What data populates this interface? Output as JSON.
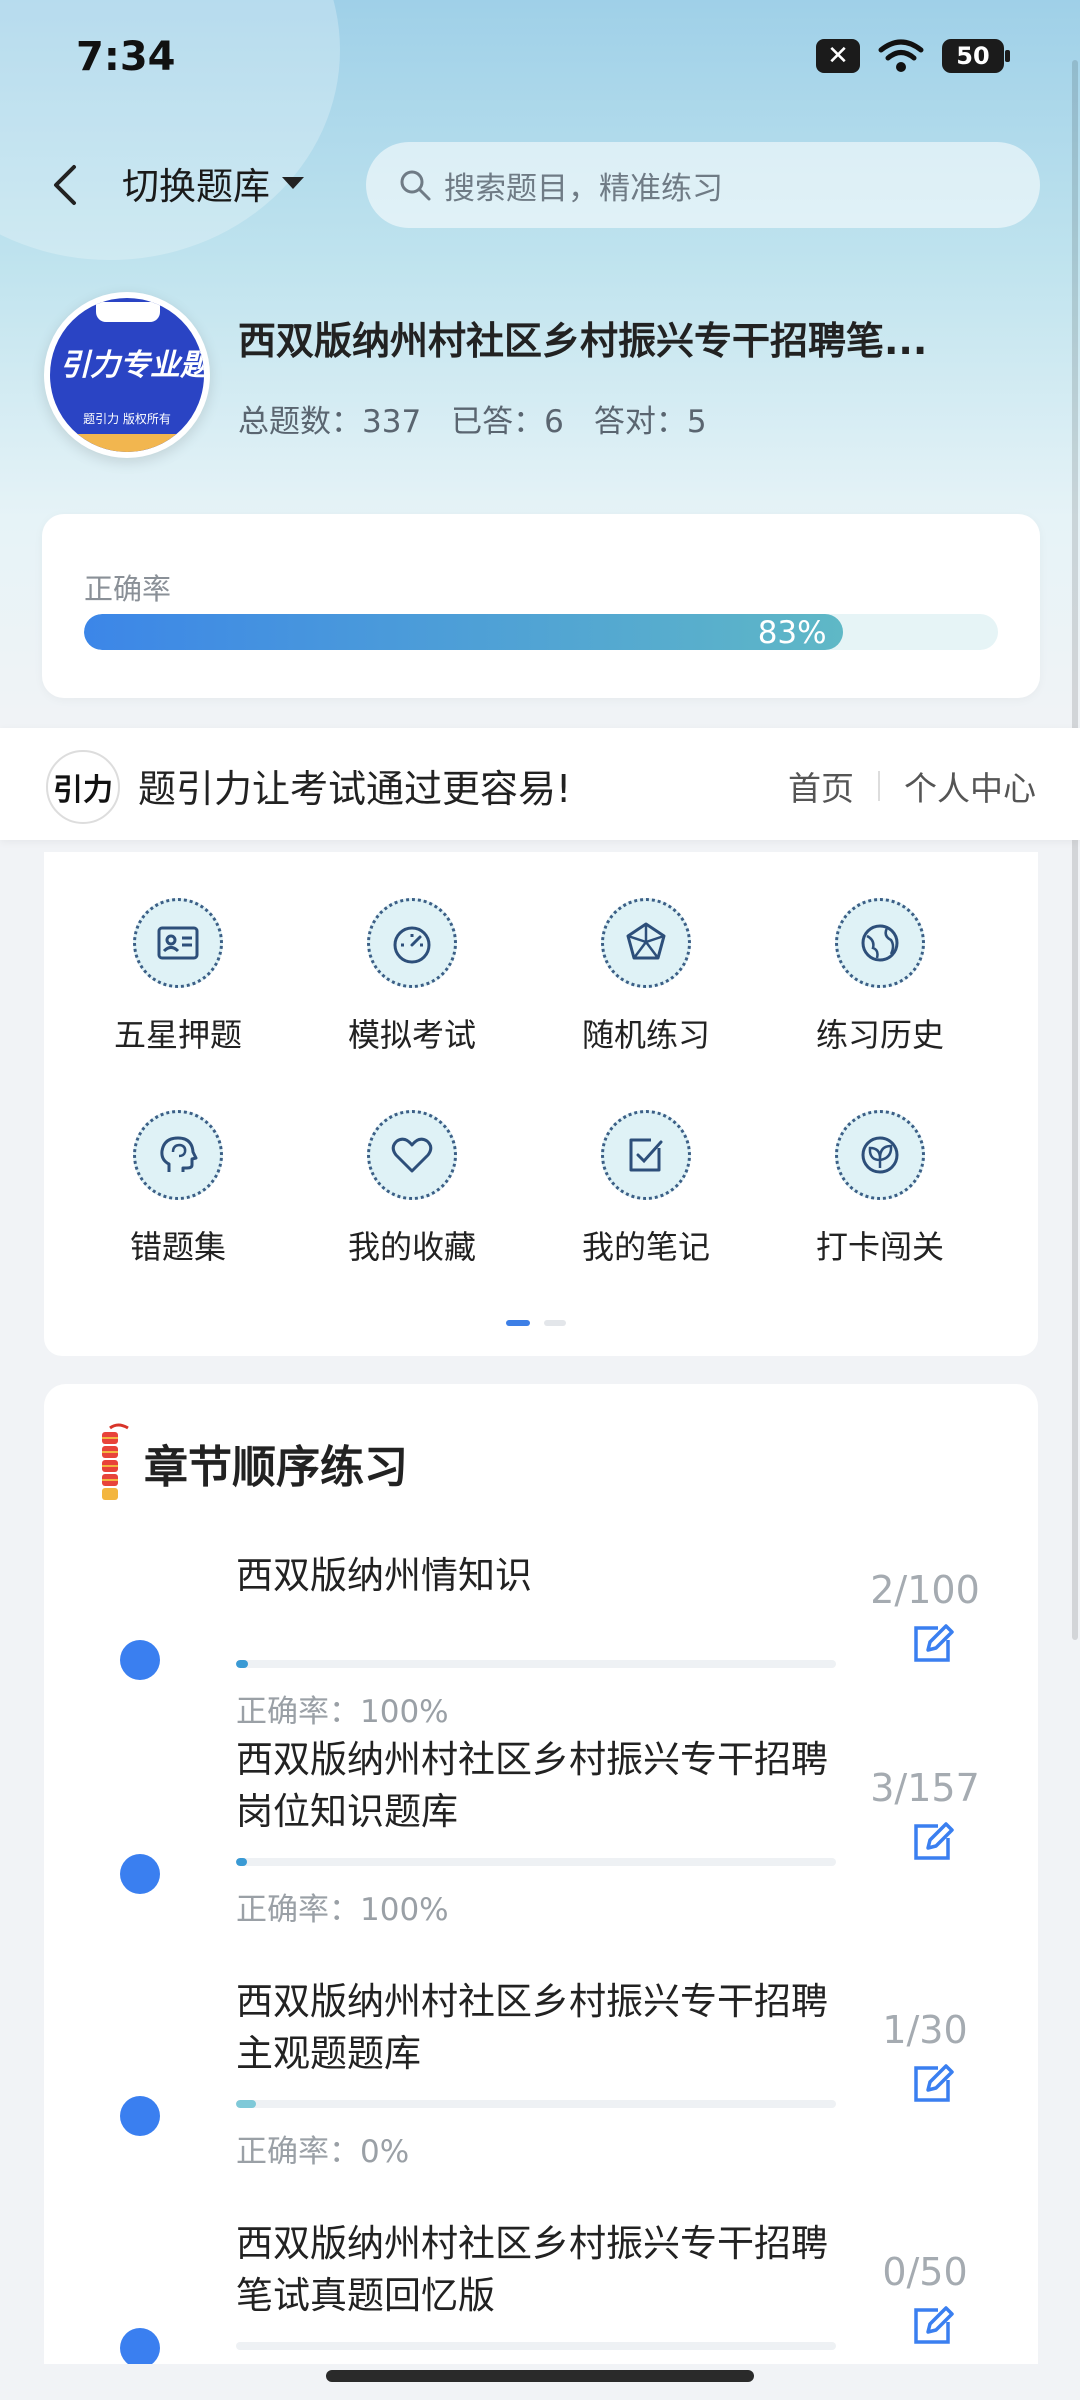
{
  "status_bar": {
    "time": "7:34",
    "battery": "50",
    "sim": "✕"
  },
  "header": {
    "switch_label": "切换题库",
    "search_placeholder": "搜索题目，精准练习"
  },
  "bank": {
    "cover_title": "引力专业题",
    "cover_sub": "题引力 版权所有",
    "title": "西双版纳州村社区乡村振兴专干招聘笔...",
    "stats": {
      "total_label": "总题数：337",
      "answered_label": "已答：6",
      "correct_label": "答对：5"
    }
  },
  "accuracy": {
    "label": "正确率",
    "percent_text": "83%",
    "value": 0.83
  },
  "brand": {
    "logo_text": "引力",
    "slogan": "题引力让考试通过更容易!",
    "links": [
      "首页",
      "个人中心"
    ]
  },
  "functions": [
    {
      "label": "五星押题",
      "icon": "id-card-icon"
    },
    {
      "label": "模拟考试",
      "icon": "gauge-icon"
    },
    {
      "label": "随机练习",
      "icon": "dice-icon"
    },
    {
      "label": "练习历史",
      "icon": "globe-icon"
    },
    {
      "label": "错题集",
      "icon": "head-icon"
    },
    {
      "label": "我的收藏",
      "icon": "heart-icon"
    },
    {
      "label": "我的笔记",
      "icon": "note-check-icon"
    },
    {
      "label": "打卡闯关",
      "icon": "leaf-icon"
    }
  ],
  "pager": {
    "pages": 2,
    "active": 1
  },
  "chapters": {
    "title": "章节顺序练习",
    "items": [
      {
        "name": "西双版纳州情知识",
        "accuracy": "正确率：100%",
        "count": "2/100",
        "progress": 0.02
      },
      {
        "name": "西双版纳州村社区乡村振兴专干招聘岗位知识题库",
        "accuracy": "正确率：100%",
        "count": "3/157",
        "progress": 0.019
      },
      {
        "name": "西双版纳州村社区乡村振兴专干招聘主观题题库",
        "accuracy": "正确率：0%",
        "count": "1/30",
        "progress": 0.033
      },
      {
        "name": "西双版纳州村社区乡村振兴专干招聘笔试真题回忆版",
        "accuracy": "",
        "count": "0/50",
        "progress": 0
      }
    ]
  },
  "colors": {
    "accent": "#3a7ff0",
    "progress_start": "#3c86e8",
    "progress_end": "#5fb8c6"
  }
}
